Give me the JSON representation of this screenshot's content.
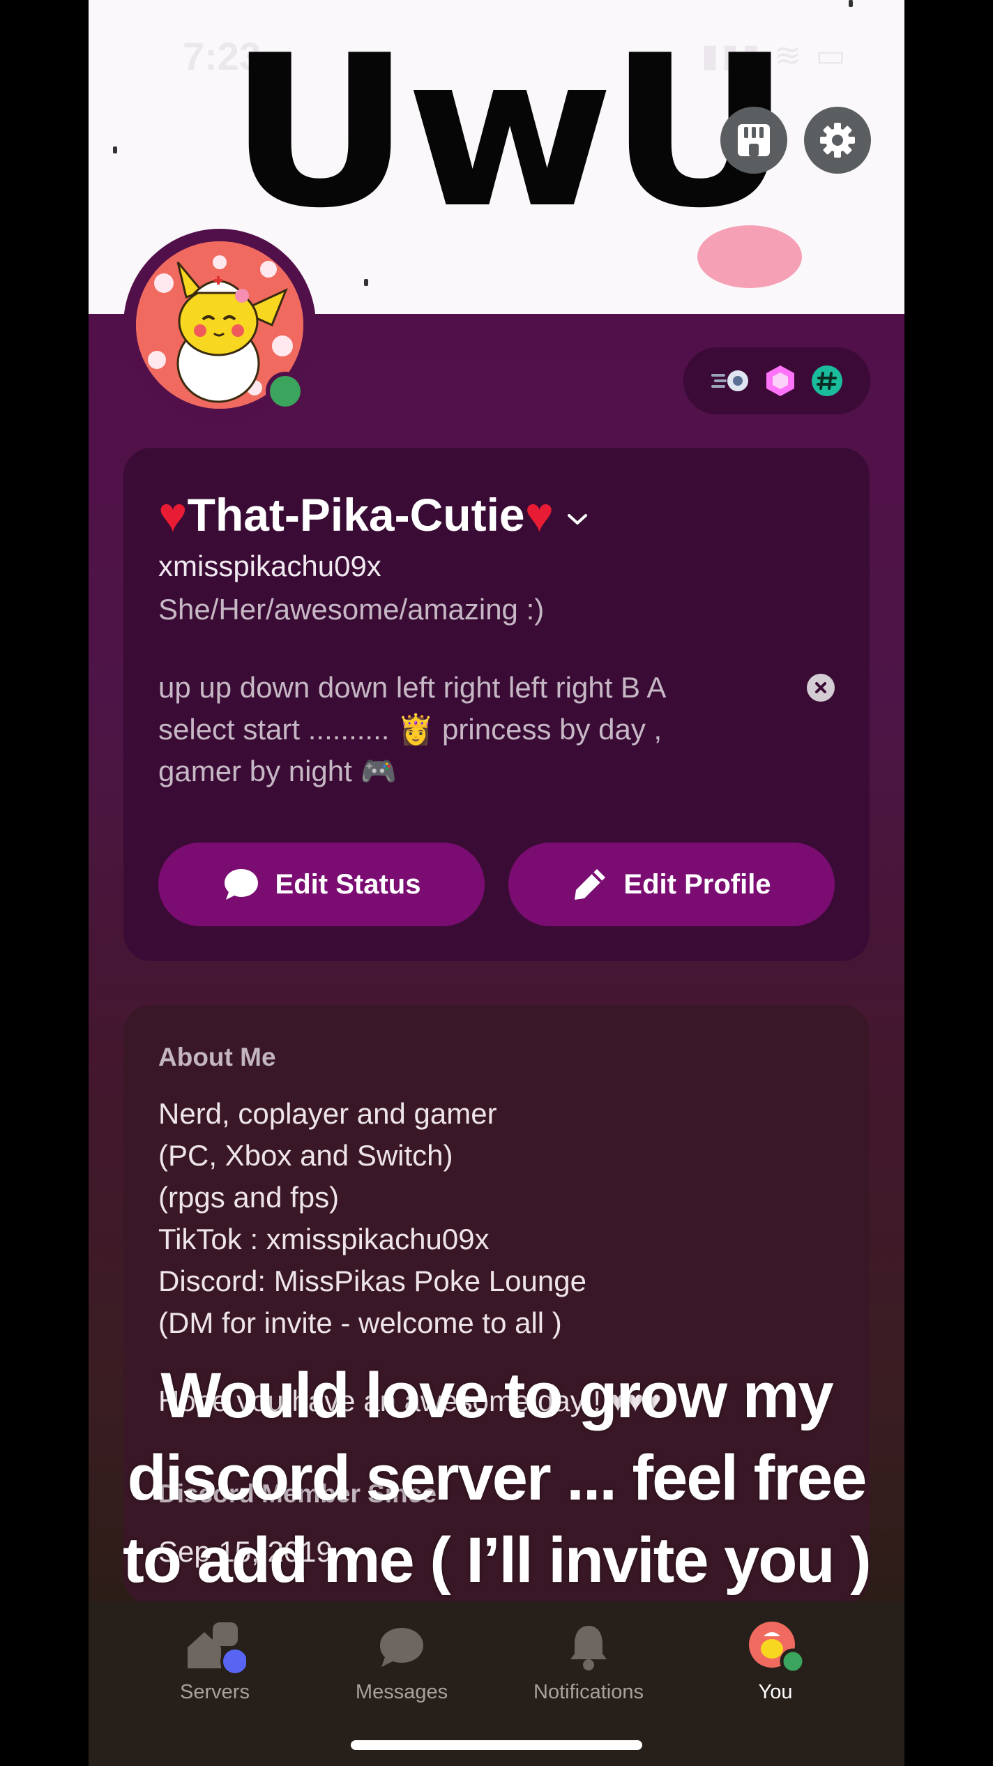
{
  "status_bar": {
    "time": "7:23",
    "icons": "▮▮▮ ≋ ▭"
  },
  "banner": {
    "text": "UwU"
  },
  "profile": {
    "display_name": "That-Pika-Cutie",
    "name_decoration": "♥",
    "username": "xmisspikachu09x",
    "pronouns": "She/Her/awesome/amazing :)",
    "custom_status": "up up down down left right left right B A\nselect start .......... 👸 princess by day ,\ngamer by night 🎮",
    "badges": [
      "speed-badge-icon",
      "nitro-gem-icon",
      "hashtag-badge-icon"
    ]
  },
  "actions": {
    "edit_status": "Edit Status",
    "edit_profile": "Edit Profile"
  },
  "about": {
    "title": "About Me",
    "text": "Nerd, coplayer and gamer\n(PC, Xbox and Switch)\n(rpgs and fps)\nTikTok : xmisspikachu09x\nDiscord: MissPikas Poke Lounge\n(DM for invite - welcome to all )",
    "closing": "Hope you have an awesome day!! ♥♥♥"
  },
  "member_since": {
    "title": "Discord Member Since",
    "date": "Sep 15, 2019"
  },
  "caption": "Would love to grow my\ndiscord server ... feel free\nto add me ( I’ll invite you )",
  "nav": [
    {
      "label": "Servers"
    },
    {
      "label": "Messages"
    },
    {
      "label": "Notifications"
    },
    {
      "label": "You"
    }
  ],
  "colors": {
    "profile_theme": "#52104a",
    "button": "#7a0c72",
    "online": "#3ba55d",
    "unread": "#5865f2"
  }
}
